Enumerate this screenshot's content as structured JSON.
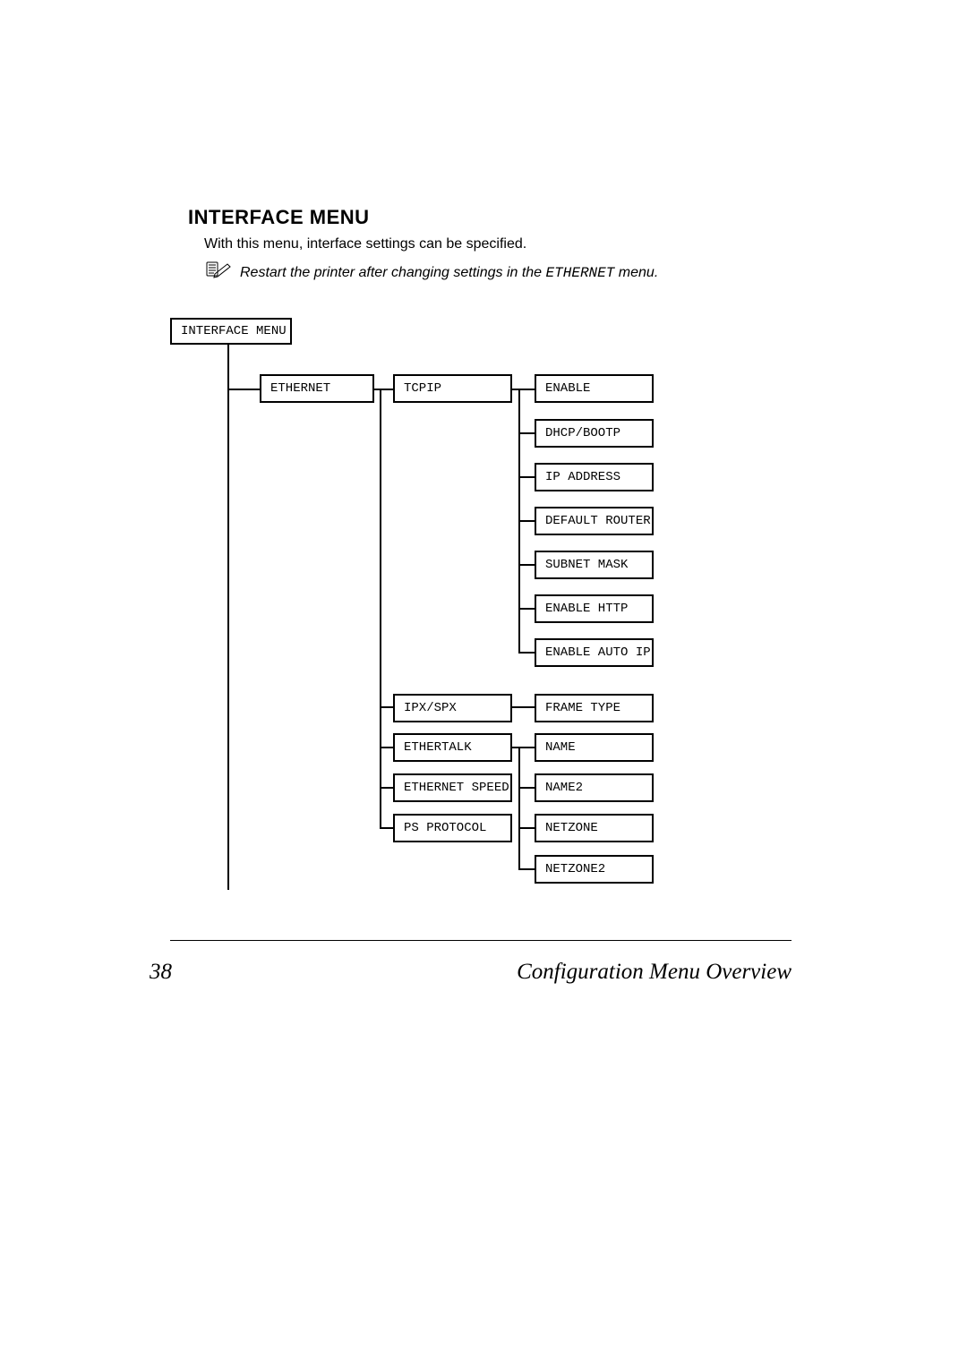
{
  "heading": "INTERFACE MENU",
  "intro": "With this menu, interface settings can be specified.",
  "note_prefix": "Restart the printer after changing settings in the ",
  "note_mono": "ETHERNET",
  "note_suffix": " menu.",
  "root": {
    "label": "INTERFACE MENU"
  },
  "col1": {
    "ethernet": "ETHERNET"
  },
  "col2": {
    "tcpip": "TCPIP",
    "ipxspx": "IPX/SPX",
    "ethertalk": "ETHERTALK",
    "speed": "ETHERNET SPEED",
    "ps": "PS PROTOCOL"
  },
  "col3": {
    "enable": "ENABLE",
    "dhcp": "DHCP/BOOTP",
    "ip": "IP ADDRESS",
    "router": "DEFAULT ROUTER",
    "subnet": "SUBNET MASK",
    "http": "ENABLE HTTP",
    "autoip": "ENABLE AUTO IP",
    "frame": "FRAME TYPE",
    "name": "NAME",
    "name2": "NAME2",
    "netzone": "NETZONE",
    "netzone2": "NETZONE2"
  },
  "footer": {
    "page": "38",
    "title": "Configuration Menu Overview"
  }
}
